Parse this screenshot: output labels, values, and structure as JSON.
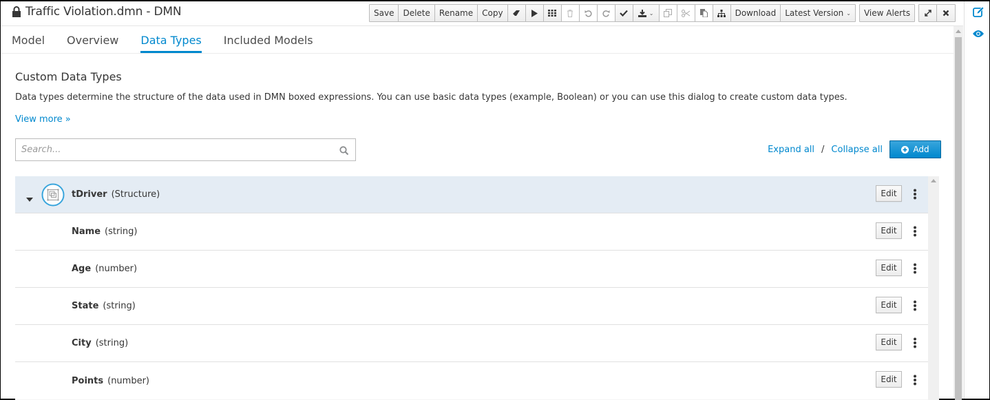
{
  "header": {
    "title": "Traffic Violation.dmn - DMN",
    "toolbar": {
      "save": "Save",
      "delete": "Delete",
      "rename": "Rename",
      "copy": "Copy",
      "download": "Download",
      "latest_version": "Latest Version",
      "view_alerts": "View Alerts"
    }
  },
  "tabs": [
    {
      "label": "Model",
      "active": false
    },
    {
      "label": "Overview",
      "active": false
    },
    {
      "label": "Data Types",
      "active": true
    },
    {
      "label": "Included Models",
      "active": false
    }
  ],
  "content": {
    "heading": "Custom Data Types",
    "description": "Data types determine the structure of the data used in DMN boxed expressions. You can use basic data types (example, Boolean) or you can use this dialog to create custom data types.",
    "view_more": "View more »",
    "search_placeholder": "Search...",
    "expand_all": "Expand all",
    "separator": "/",
    "collapse_all": "Collapse all",
    "add": "Add"
  },
  "data_types": [
    {
      "name": "tDriver",
      "type": "(Structure)",
      "edit": "Edit",
      "is_structure": true,
      "expanded": true
    },
    {
      "name": "Name",
      "type": "(string)",
      "edit": "Edit"
    },
    {
      "name": "Age",
      "type": "(number)",
      "edit": "Edit"
    },
    {
      "name": "State",
      "type": "(string)",
      "edit": "Edit"
    },
    {
      "name": "City",
      "type": "(string)",
      "edit": "Edit"
    },
    {
      "name": "Points",
      "type": "(number)",
      "edit": "Edit"
    }
  ],
  "colors": {
    "accent": "#0088ce",
    "selected_row": "#e4ecf4"
  }
}
